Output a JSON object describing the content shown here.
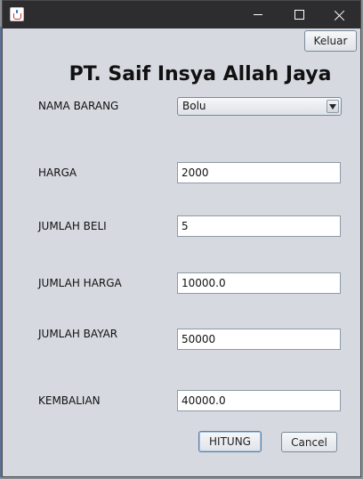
{
  "window": {
    "title_bar": {
      "minimize_icon": "minimize-icon",
      "maximize_icon": "maximize-icon",
      "close_icon": "close-icon",
      "app_icon": "java-cup-icon"
    }
  },
  "header": {
    "company_title": "PT. Saif Insya Allah Jaya"
  },
  "toolbar": {
    "exit_label": "Keluar"
  },
  "form": {
    "item_name": {
      "label": "NAMA BARANG",
      "selected": "Bolu"
    },
    "price": {
      "label": "HARGA",
      "value": "2000"
    },
    "quantity": {
      "label": "JUMLAH BELI",
      "value": "5"
    },
    "total_price": {
      "label": "JUMLAH HARGA",
      "value": "10000.0"
    },
    "amount_paid": {
      "label": "JUMLAH BAYAR",
      "value": "50000"
    },
    "change": {
      "label": "KEMBALIAN",
      "value": "40000.0"
    }
  },
  "actions": {
    "calculate_label": "HITUNG",
    "cancel_label": "Cancel"
  }
}
